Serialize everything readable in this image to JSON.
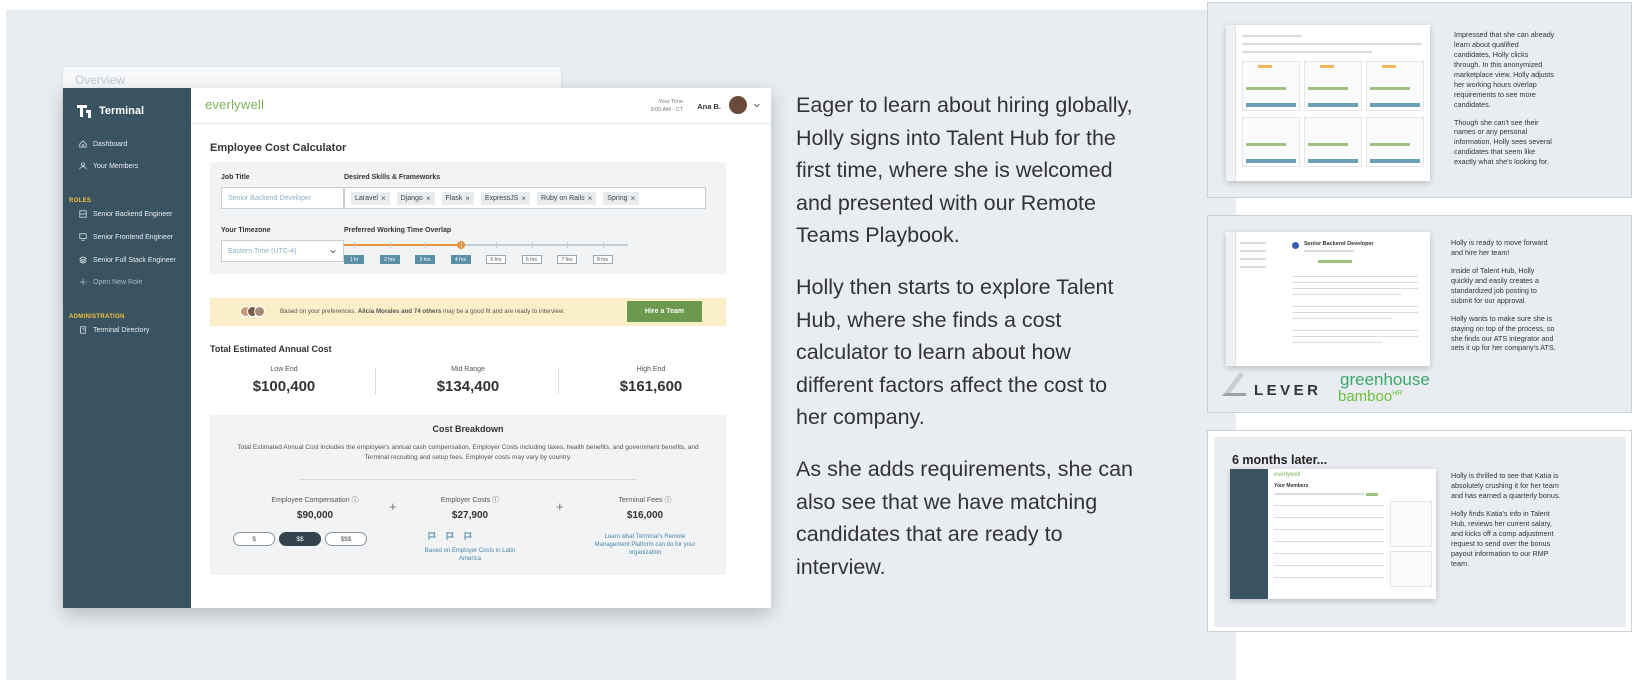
{
  "app": {
    "overview_label": "Overview",
    "brand": "Terminal",
    "logo": "everlywell",
    "your_time_label": "Your Time",
    "your_time_value": "9:00 AM - CT",
    "user_name": "Ana B.",
    "sidebar": {
      "items": [
        {
          "label": "Dashboard",
          "icon": "home-icon"
        },
        {
          "label": "Your Members",
          "icon": "user-icon"
        }
      ],
      "roles_heading": "ROLES",
      "roles": [
        {
          "label": "Senior Backend Engineer",
          "icon": "server-icon"
        },
        {
          "label": "Senior Frontend Engineer",
          "icon": "monitor-icon"
        },
        {
          "label": "Senior Full Stack Engineer",
          "icon": "layers-icon"
        },
        {
          "label": "Open New Role",
          "icon": "plus-icon"
        }
      ],
      "admin_heading": "ADMINISTRATION",
      "admin": [
        {
          "label": "Terminal Directory",
          "icon": "book-icon"
        }
      ]
    },
    "calculator": {
      "title": "Employee Cost Calculator",
      "job_title_label": "Job Title",
      "job_title_placeholder": "Senior Backend Developer",
      "skills_label": "Desired Skills & Frameworks",
      "skills": [
        "Laravel",
        "Django",
        "Flask",
        "ExpressJS",
        "Ruby on Rails",
        "Spring"
      ],
      "timezone_label": "Your Timezone",
      "timezone_value": "Eastern Time (UTC-4)",
      "overlap_label": "Preferred Working Time Overlap",
      "hours": [
        "1 hr",
        "2 hrs",
        "3 hrs",
        "4 hrs",
        "5 hrs",
        "6 hrs",
        "7 hrs",
        "8 hrs"
      ],
      "overlap_selected_hours": 4
    },
    "banner": {
      "prefix": "Based on your preferences, ",
      "highlight": "Alicia Morales and 74 others",
      "suffix": " may be a good fit and are ready to interview.",
      "button": "Hire a Team"
    },
    "totals": {
      "title": "Total Estimated Annual Cost",
      "low_label": "Low End",
      "low_value": "$100,400",
      "mid_label": "Mid Range",
      "mid_value": "$134,400",
      "high_label": "High End",
      "high_value": "$161,600"
    },
    "breakdown": {
      "title": "Cost Breakdown",
      "description": "Total Estimated Annual Cost includes the employee's annual cash compensation, Employer Costs including taxes, health benefits, and government benefits, and Terminal recruiting and setup fees. Employer costs may vary by country.",
      "comp_label": "Employee Compensation",
      "comp_value": "$90,000",
      "comp_options": [
        "$",
        "$$",
        "$$$"
      ],
      "employer_label": "Employer Costs",
      "employer_value": "$27,900",
      "employer_note": "Based on Employer Costs in Latin America",
      "fees_label": "Terminal Fees",
      "fees_value": "$16,000",
      "fees_link": "Learn what Terminal's Remote Management Platform can do for your organization"
    }
  },
  "narrative": [
    "Eager to learn about hiring globally, Holly signs into Talent Hub for the first time, where she is welcomed and presented with our Remote Teams Playbook.",
    "Holly then starts to explore Talent Hub, where she finds a cost calculator to learn about how different factors affect the cost to her company.",
    "As she adds requirements, she can also see that we have matching candidates that are ready to interview."
  ],
  "cards": {
    "marketplace": [
      "Impressed that she can already learn about qualified candidates, Holly clicks through. In this anonymized marketplace view, Holly adjusts her working hours overlap requirements to see more candidates.",
      "Though she can't see their names or any personal information, Holly sees several candidates that seem like exactly what she's looking for."
    ],
    "hire": [
      "Holly is ready to move forward and hire her team!",
      "Inside of Talent Hub, Holly quickly and easily creates a standardized job posting to submit for our approval.",
      "Holly wants to make sure she is staying on top of the process, so she finds our ATS integrator and sets it up for her company's ATS."
    ],
    "hire_mock_title": "Senior Backend Developer",
    "logos": {
      "lever": "LEVER",
      "greenhouse": "greenhouse",
      "bamboo": "bamboo",
      "bamboo_suffix": "HR"
    },
    "later_heading": "6 months later...",
    "later": [
      "Holly is thrilled to see that Katia is absolutely crushing it for her team and has earned a quarterly bonus.",
      "Holly finds Katia's info in Talent Hub, reviews her current salary, and kicks off a comp adjustment request to send over the bonus payout information to our RMP team."
    ],
    "later_mock_logo": "everlywell",
    "later_mock_title": "Your Members"
  }
}
